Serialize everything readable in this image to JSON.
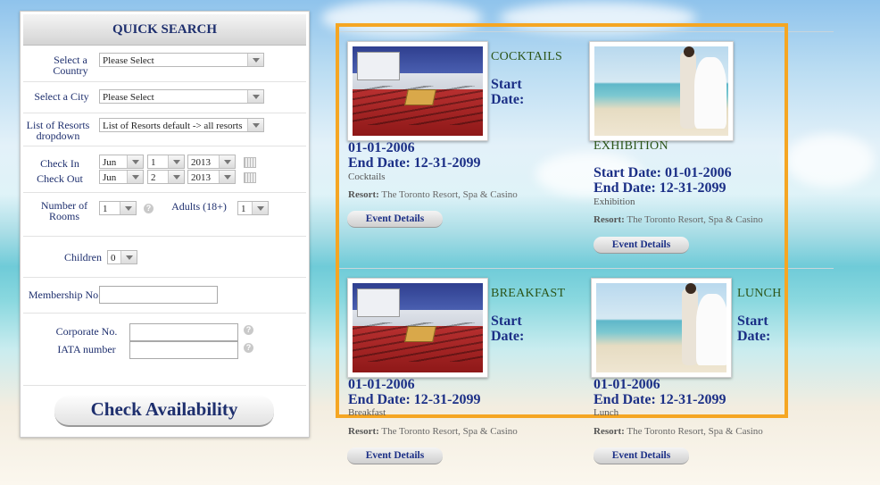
{
  "quick_search": {
    "title": "QUICK SEARCH",
    "country_label": "Select a Country",
    "country_value": "Please Select",
    "city_label": "Select a City",
    "city_value": "Please Select",
    "resorts_label": "List of Resorts dropdown",
    "resorts_value": "List of Resorts default -> all resorts",
    "check_in_label": "Check In",
    "check_in": {
      "month": "Jun",
      "day": "1",
      "year": "2013"
    },
    "check_out_label": "Check Out",
    "check_out": {
      "month": "Jun",
      "day": "2",
      "year": "2013"
    },
    "rooms_label": "Number of Rooms",
    "rooms_value": "1",
    "adults_label": "Adults (18+)",
    "adults_value": "1",
    "children_label": "Children",
    "children_value": "0",
    "membership_label": "Membership No",
    "corporate_label": "Corporate No.",
    "iata_label": "IATA number",
    "help_glyph": "?",
    "check_button": "Check Availability"
  },
  "events": [
    {
      "title": "COCKTAILS",
      "start_label": "Start Date:",
      "start_date": "01-01-2006",
      "end_line": "End Date: 12-31-2099",
      "category": "Cocktails",
      "resort_label": "Resort:",
      "resort": "The Toronto Resort, Spa & Casino",
      "button": "Event Details",
      "image": "conference-room"
    },
    {
      "title": "EXHIBITION",
      "start_line": "Start Date: 01-01-2006",
      "end_line": "End Date: 12-31-2099",
      "category": "Exhibition",
      "resort_label": "Resort:",
      "resort": "The Toronto Resort, Spa & Casino",
      "button": "Event Details",
      "image": "beach-wedding"
    },
    {
      "title": "BREAKFAST",
      "start_label": "Start Date:",
      "start_date": "01-01-2006",
      "end_line": "End Date: 12-31-2099",
      "category": "Breakfast",
      "resort_label": "Resort:",
      "resort": "The Toronto Resort, Spa & Casino",
      "button": "Event Details",
      "image": "conference-room"
    },
    {
      "title": "LUNCH",
      "start_label": "Start Date:",
      "start_date": "01-01-2006",
      "end_line": "End Date: 12-31-2099",
      "category": "Lunch",
      "resort_label": "Resort:",
      "resort": "The Toronto Resort, Spa & Casino",
      "button": "Event Details",
      "image": "beach-wedding"
    }
  ],
  "colors": {
    "highlight": "#f5a623",
    "title_green": "#2b5418",
    "date_blue": "#1b2f86",
    "panel_heading": "#1e2f6e"
  }
}
